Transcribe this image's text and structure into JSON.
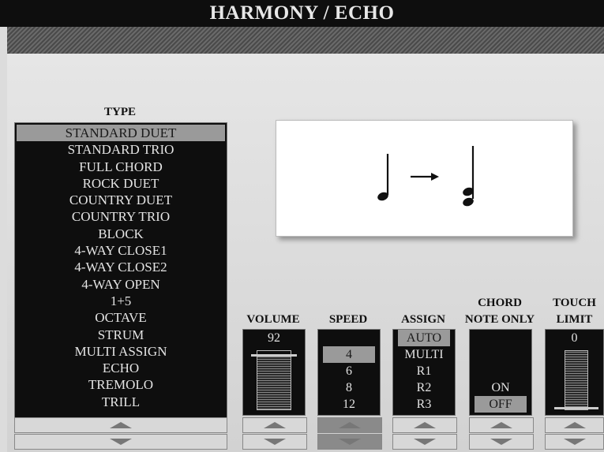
{
  "window": {
    "title": "HARMONY / ECHO"
  },
  "type_panel": {
    "label": "TYPE",
    "items": [
      "STANDARD DUET",
      "STANDARD TRIO",
      "FULL CHORD",
      "ROCK DUET",
      "COUNTRY DUET",
      "COUNTRY TRIO",
      "BLOCK",
      "4-WAY CLOSE1",
      "4-WAY CLOSE2",
      "4-WAY OPEN",
      "1+5",
      "OCTAVE",
      "STRUM",
      "MULTI ASSIGN",
      "ECHO",
      "TREMOLO",
      "TRILL"
    ],
    "selected": "STANDARD DUET"
  },
  "volume": {
    "label": "VOLUME",
    "value": "92",
    "level": 0.92
  },
  "speed": {
    "label": "SPEED",
    "options": [
      "4",
      "6",
      "8",
      "12"
    ],
    "selected": "4"
  },
  "assign": {
    "label": "ASSIGN",
    "options": [
      "AUTO",
      "MULTI",
      "R1",
      "R2",
      "R3"
    ],
    "selected": "AUTO"
  },
  "chord_note_only": {
    "label_line1": "CHORD",
    "label_line2": "NOTE ONLY",
    "options": [
      "ON",
      "OFF"
    ],
    "selected": "OFF"
  },
  "touch_limit": {
    "label_line1": "TOUCH",
    "label_line2": "LIMIT",
    "value": "0",
    "level": 0.0
  },
  "icons": {
    "up": "up-arrow-icon",
    "down": "down-arrow-icon"
  }
}
